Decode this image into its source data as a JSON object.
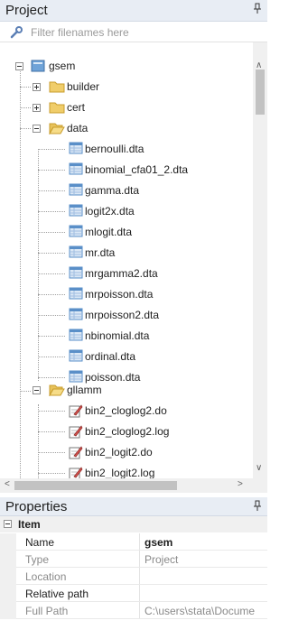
{
  "project_panel": {
    "title": "Project",
    "filter_placeholder": "Filter filenames here"
  },
  "tree": {
    "root": "gsem",
    "builder": "builder",
    "cert": "cert",
    "data": "data",
    "data_files": [
      "bernoulli.dta",
      "binomial_cfa01_2.dta",
      "gamma.dta",
      "logit2x.dta",
      "mlogit.dta",
      "mr.dta",
      "mrgamma2.dta",
      "mrpoisson.dta",
      "mrpoisson2.dta",
      "nbinomial.dta",
      "ordinal.dta",
      "poisson.dta"
    ],
    "gllamm": "gllamm",
    "gllamm_files": [
      "bin2_cloglog2.do",
      "bin2_cloglog2.log",
      "bin2_logit2.do",
      "bin2_logit2.log"
    ]
  },
  "properties_panel": {
    "title": "Properties",
    "category": "Item",
    "rows": [
      {
        "name": "Name",
        "value": "gsem"
      },
      {
        "name": "Type",
        "value": "Project"
      },
      {
        "name": "Location",
        "value": ""
      },
      {
        "name": "Relative path",
        "value": ""
      },
      {
        "name": "Full Path",
        "value": "C:\\users\\stata\\Docume"
      }
    ]
  },
  "colors": {
    "header_bg": "#e8edf4",
    "folder": "#e8c25a",
    "file_dta": "#5a8fc8"
  }
}
